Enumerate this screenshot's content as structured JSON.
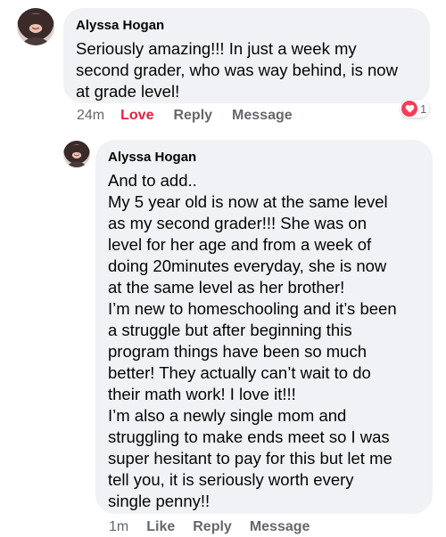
{
  "comments": [
    {
      "author": "Alyssa Hogan",
      "text": "Seriously amazing!!! In just a week my\nsecond grader, who was way behind, is now\nat grade level!",
      "time": "24m",
      "like_label": "Love",
      "reply_label": "Reply",
      "message_label": "Message",
      "reaction_count": "1",
      "reaction_icon": "heart-icon",
      "reaction_color": "#f33e58",
      "like_color": "#e41e3f"
    },
    {
      "author": "Alyssa Hogan",
      "text": "And to add..\nMy 5 year old is now at the same level\nas my second grader!!! She was on\nlevel for her age and from a week of\ndoing 20minutes everyday, she is now\nat the same level as her brother!\nI’m new to homeschooling and it’s been\na struggle but after beginning this\nprogram things have been so much\nbetter! They actually can’t wait to do\ntheir math work! I love it!!!\nI’m also a newly single mom and\nstruggling to make ends meet so I was\nsuper hesitant to pay for this but let me\ntell you, it is seriously worth every\nsingle penny!!",
      "time": "1m",
      "like_label": "Like",
      "reply_label": "Reply",
      "message_label": "Message"
    }
  ],
  "colors": {
    "bubble": "#f0f2f5",
    "meta_text": "#65676b",
    "body_text": "#050505"
  }
}
